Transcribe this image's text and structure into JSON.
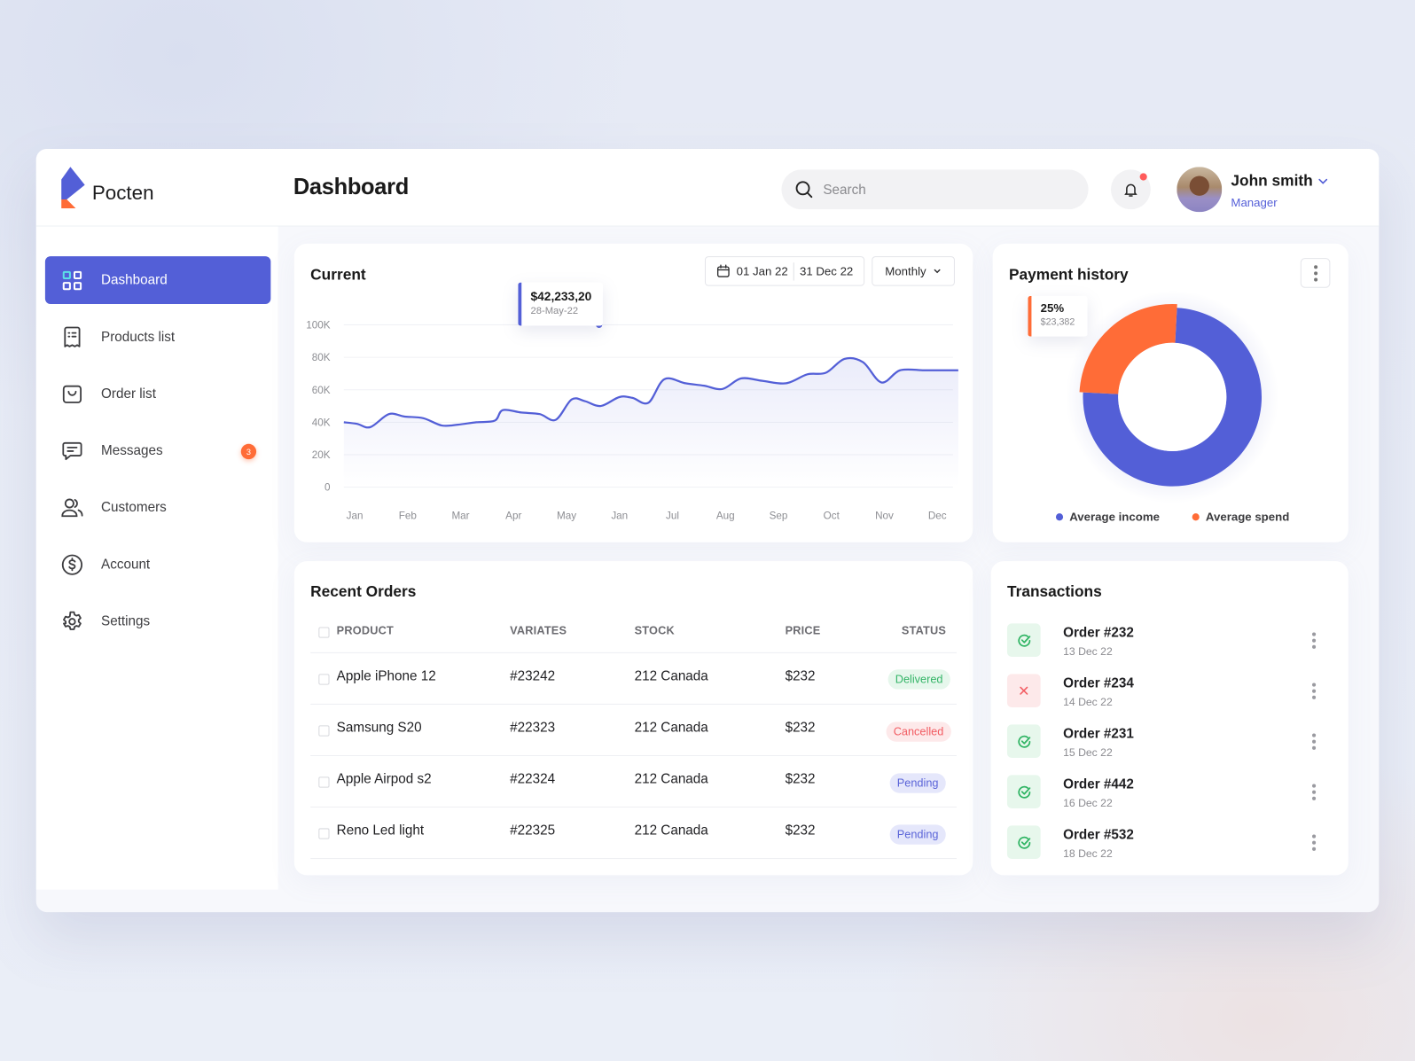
{
  "brand": {
    "name": "Pocten",
    "colors": {
      "primary": "#535fd7",
      "accent": "#ff6c37"
    }
  },
  "header": {
    "title": "Dashboard",
    "search_placeholder": "Search",
    "notification_icon": "bell-icon",
    "notification_dot": true,
    "user": {
      "name": "John smith",
      "role": "Manager"
    }
  },
  "sidebar": {
    "items": [
      {
        "label": "Dashboard",
        "icon": "grid-icon",
        "active": true
      },
      {
        "label": "Products list",
        "icon": "receipt-icon"
      },
      {
        "label": "Order list",
        "icon": "bag-icon"
      },
      {
        "label": "Messages",
        "icon": "message-icon",
        "badge": "3"
      },
      {
        "label": "Customers",
        "icon": "users-icon"
      },
      {
        "label": "Account",
        "icon": "dollar-circle-icon"
      },
      {
        "label": "Settings",
        "icon": "gear-icon"
      }
    ]
  },
  "current_card": {
    "title": "Current",
    "date_from": "01 Jan 22",
    "date_to": "31 Dec 22",
    "period": "Monthly",
    "tooltip": {
      "value": "$42,233,20",
      "date": "28-May-22"
    }
  },
  "payment_card": {
    "title": "Payment history",
    "tooltip": {
      "percent": "25%",
      "amount": "$23,382"
    },
    "legend": [
      {
        "label": "Average income",
        "color": "#535fd7"
      },
      {
        "label": "Average spend",
        "color": "#ff6c37"
      }
    ]
  },
  "orders_card": {
    "title": "Recent Orders",
    "columns": [
      "PRODUCT",
      "VARIATES",
      "STOCK",
      "PRICE",
      "STATUS"
    ],
    "rows": [
      {
        "product": "Apple iPhone 12",
        "variates": "#23242",
        "stock": "212 Canada",
        "price": "$232",
        "status": "Delivered",
        "status_type": "delivered"
      },
      {
        "product": "Samsung S20",
        "variates": "#22323",
        "stock": "212 Canada",
        "price": "$232",
        "status": "Cancelled",
        "status_type": "cancelled"
      },
      {
        "product": "Apple Airpod s2",
        "variates": "#22324",
        "stock": "212 Canada",
        "price": "$232",
        "status": "Pending",
        "status_type": "pending"
      },
      {
        "product": "Reno Led light",
        "variates": "#22325",
        "stock": "212 Canada",
        "price": "$232",
        "status": "Pending",
        "status_type": "pending"
      }
    ]
  },
  "transactions_card": {
    "title": "Transactions",
    "items": [
      {
        "title": "Order #232",
        "date": "13 Dec 22",
        "state": "success"
      },
      {
        "title": "Order #234",
        "date": "14 Dec 22",
        "state": "failed"
      },
      {
        "title": "Order #231",
        "date": "15 Dec 22",
        "state": "success"
      },
      {
        "title": "Order #442",
        "date": "16 Dec 22",
        "state": "success"
      },
      {
        "title": "Order #532",
        "date": "18 Dec 22",
        "state": "success"
      }
    ]
  },
  "chart_data": [
    {
      "type": "area",
      "title": "Current",
      "xlabel": "",
      "ylabel": "",
      "categories": [
        "Jan",
        "Feb",
        "Mar",
        "Apr",
        "May",
        "Jan",
        "Jul",
        "Aug",
        "Sep",
        "Oct",
        "Nov",
        "Dec"
      ],
      "y_ticks": [
        "0",
        "20K",
        "40K",
        "60K",
        "80K",
        "100K"
      ],
      "ylim": [
        0,
        100000
      ],
      "grid": true,
      "series": [
        {
          "name": "Current",
          "color": "#535fd7",
          "x": [
            0,
            0.25,
            0.5,
            0.85,
            1.15,
            1.5,
            1.85,
            2.15,
            2.5,
            2.85,
            3.0,
            3.35,
            3.7,
            4.0,
            4.3,
            4.55,
            4.85,
            5.2,
            5.45,
            5.75,
            6.05,
            6.45,
            6.8,
            7.15,
            7.5,
            7.9,
            8.35,
            8.75,
            9.1,
            9.45,
            9.8,
            10.15,
            10.5,
            10.95,
            11.3,
            11.6
          ],
          "values": [
            40000,
            39000,
            37000,
            45000,
            43500,
            42500,
            38000,
            38500,
            40000,
            41000,
            47500,
            46000,
            45000,
            41500,
            54000,
            53000,
            50000,
            55500,
            55000,
            52000,
            66500,
            64000,
            62500,
            60500,
            67000,
            65500,
            64000,
            69500,
            70500,
            79000,
            77000,
            64500,
            72000,
            72000,
            72000,
            72000
          ]
        }
      ],
      "highlight": {
        "category": "May",
        "label": "$42,233,20",
        "date": "28-May-22"
      }
    },
    {
      "type": "pie",
      "title": "Payment history",
      "series": [
        {
          "name": "Average income",
          "value": 75,
          "color": "#535fd7"
        },
        {
          "name": "Average spend",
          "value": 25,
          "color": "#ff6c37",
          "amount": "$23,382"
        }
      ]
    }
  ]
}
